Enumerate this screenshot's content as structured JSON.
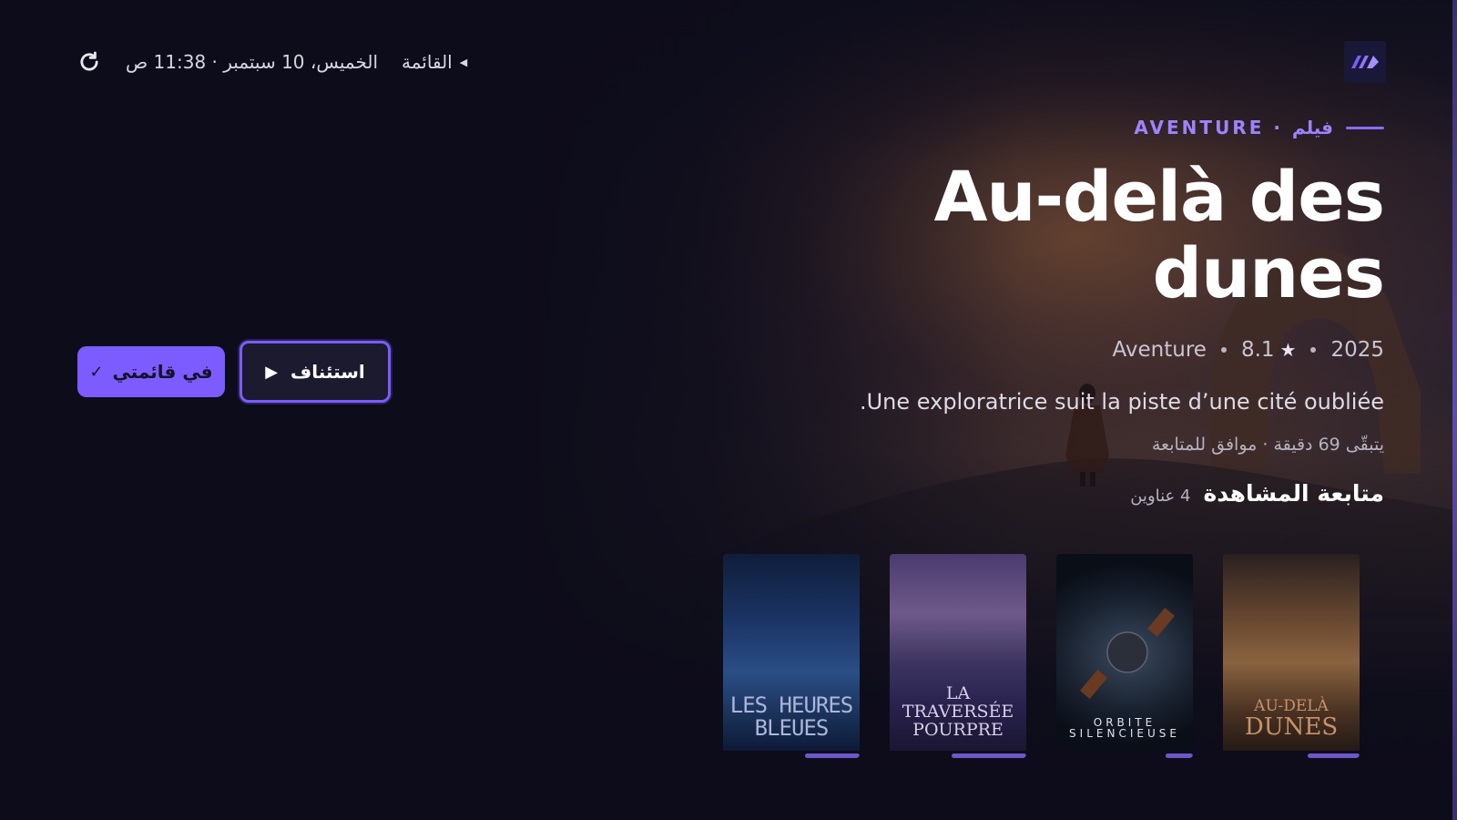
{
  "topbar": {
    "clock": "الخميس، 10 سبتمبر · 11:38 ص",
    "menu_label": "القائمة",
    "refresh_icon": "refresh-icon",
    "logo_icon": "app-logo"
  },
  "hero": {
    "eyebrow": "AVENTURE · فيلم",
    "title": "Au-delà des dunes",
    "year": "2025",
    "rating": "8.1",
    "genre": "Aventure",
    "synopsis": ".Une exploratrice suit la piste d’une cité oubliée",
    "remaining": "يتبقّى 69 دقيقة · موافق للمتابعة",
    "accent_color": "#7c5cff"
  },
  "actions": {
    "resume_label": "استئناف",
    "watchlist_label": "في قائمتي"
  },
  "continue_watching": {
    "title": "متابعة المشاهدة",
    "count": "4 عناوين",
    "items": [
      {
        "title_line1": "LES HEURES BLEUES",
        "title_line2": "",
        "progress": 0.4
      },
      {
        "title_line1": "LA TRAVERSÉE",
        "title_line2": "POURPRE",
        "progress": 0.55
      },
      {
        "title_line1": "ORBITE",
        "title_line2": "SILENCIEUSE",
        "progress": 0.2
      },
      {
        "title_line1": "AU-DELÀ",
        "title_line2": "DUNES",
        "progress": 0.38
      }
    ]
  }
}
